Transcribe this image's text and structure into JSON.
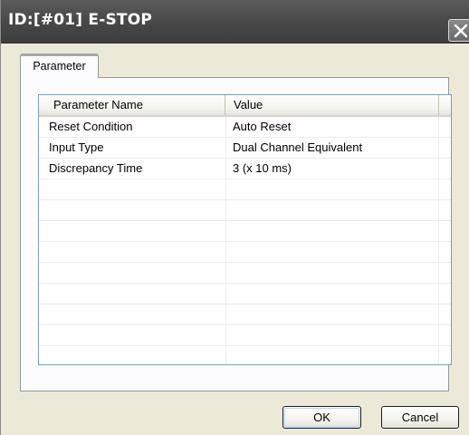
{
  "window": {
    "title": "ID:[#01]  E-STOP"
  },
  "tabs": [
    {
      "label": "Parameter",
      "selected": true
    }
  ],
  "table": {
    "columns": [
      "Parameter Name",
      "Value"
    ],
    "rows": [
      {
        "name": "Reset Condition",
        "value": "Auto Reset"
      },
      {
        "name": "Input Type",
        "value": "Dual Channel Equivalent"
      },
      {
        "name": "Discrepancy Time",
        "value": "3 (x 10 ms)"
      },
      {
        "name": "",
        "value": ""
      },
      {
        "name": "",
        "value": ""
      },
      {
        "name": "",
        "value": ""
      },
      {
        "name": "",
        "value": ""
      },
      {
        "name": "",
        "value": ""
      },
      {
        "name": "",
        "value": ""
      },
      {
        "name": "",
        "value": ""
      },
      {
        "name": "",
        "value": ""
      },
      {
        "name": "",
        "value": ""
      }
    ]
  },
  "buttons": {
    "ok_label": "OK",
    "cancel_label": "Cancel"
  },
  "icons": {
    "close": "close-icon"
  }
}
